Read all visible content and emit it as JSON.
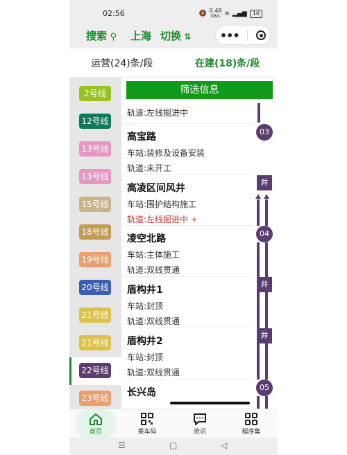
{
  "status_bar": {
    "time": "02:56",
    "net_speed": "0.48",
    "net_unit": "KB/s",
    "battery": "10"
  },
  "top_nav": {
    "search": "搜索",
    "city": "上海",
    "switch": "切换"
  },
  "tabs": [
    {
      "label": "运营(24)条/段"
    },
    {
      "label": "在建(18)条/段"
    }
  ],
  "sidebar": {
    "lines": [
      {
        "label": "2号线",
        "color": "#97c21f"
      },
      {
        "label": "12号线",
        "color": "#0c7a59"
      },
      {
        "label": "13号线",
        "color": "#e796c1"
      },
      {
        "label": "13号线",
        "color": "#e796c1"
      },
      {
        "label": "15号线",
        "color": "#c8b38b"
      },
      {
        "label": "18号线",
        "color": "#c29a53"
      },
      {
        "label": "19号线",
        "color": "#ea9f6d"
      },
      {
        "label": "20号线",
        "color": "#3b5fb0"
      },
      {
        "label": "21号线",
        "color": "#ddc14d"
      },
      {
        "label": "21号线",
        "color": "#ddc14d"
      },
      {
        "label": "22号线",
        "color": "#5a3d6e"
      },
      {
        "label": "23号线",
        "color": "#ea9f6d"
      }
    ]
  },
  "content": {
    "filter_label": "筛选信息",
    "partial_line": "轨道:左线掘进中",
    "entries": [
      {
        "title": "高宝路",
        "station": "车站:装修及设备安装",
        "track": "轨道:未开工"
      },
      {
        "title": "高凌区间风井",
        "station": "车站:围护结构施工",
        "track": "轨道:左线掘进中 +"
      },
      {
        "title": "凌空北路",
        "station": "车站:主体施工",
        "track": "轨道:双线贯通"
      },
      {
        "title": "盾构井1",
        "station": "车站:封顶",
        "track": "轨道:双线贯通"
      },
      {
        "title": "盾构井2",
        "station": "车站:封顶",
        "track": "轨道:双线贯通"
      },
      {
        "title": "长兴岛"
      }
    ],
    "markers": {
      "m03": "03",
      "m04": "04",
      "m05": "05",
      "well": "井"
    }
  },
  "tab_bar": [
    {
      "label": "首页",
      "icon": "home-icon"
    },
    {
      "label": "乘车码",
      "icon": "qr-code-icon"
    },
    {
      "label": "资讯",
      "icon": "news-icon"
    },
    {
      "label": "程序集",
      "icon": "apps-icon"
    }
  ],
  "colors": {
    "accent": "#1e8a2f",
    "line22": "#5a3d6e",
    "filter_bg": "#129b1a"
  }
}
